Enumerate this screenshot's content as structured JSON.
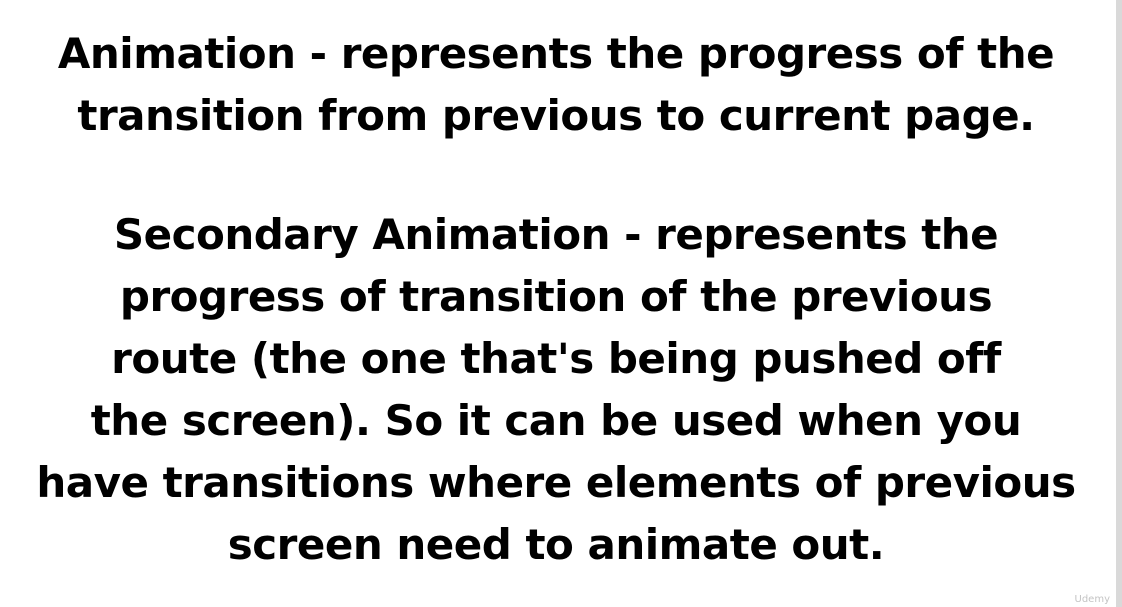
{
  "slide": {
    "paragraph1": {
      "lines": [
        "Animation - represents the progress of the",
        "transition from previous to current page."
      ]
    },
    "paragraph2": {
      "lines": [
        "Secondary Animation - represents the",
        "progress of transition of the previous",
        "route (the one that's being pushed off",
        "the screen). So it can be used when you",
        "have transitions where elements of previous",
        "screen need to animate out."
      ]
    },
    "watermark": "Udemy"
  }
}
